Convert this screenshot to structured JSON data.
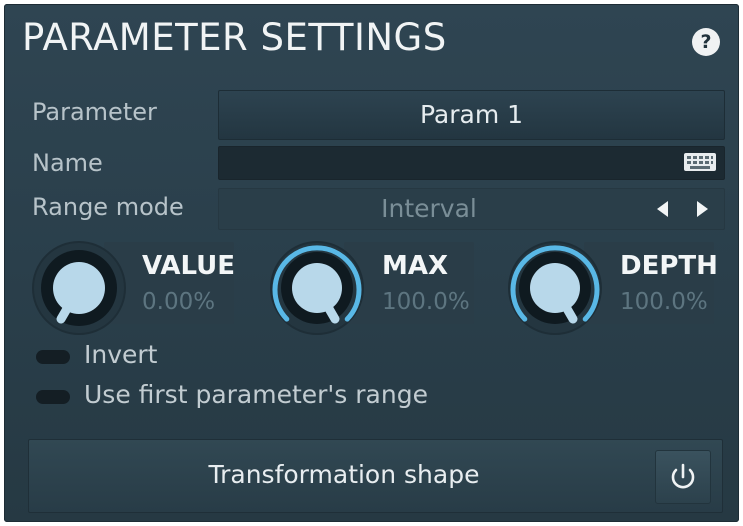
{
  "title": "PARAMETER SETTINGS",
  "help_label": "?",
  "parameter": {
    "label": "Parameter",
    "value": "Param 1"
  },
  "name": {
    "label": "Name",
    "value": "",
    "keyboard_icon": "keyboard-icon"
  },
  "range_mode": {
    "label": "Range mode",
    "value": "Interval",
    "prev_icon": "arrow-left-icon",
    "next_icon": "arrow-right-icon"
  },
  "knobs": [
    {
      "name": "VALUE",
      "value": "0.00%",
      "level": 0.0
    },
    {
      "name": "MAX",
      "value": "100.0%",
      "level": 1.0
    },
    {
      "name": "DEPTH",
      "value": "100.0%",
      "level": 1.0
    }
  ],
  "toggles": [
    {
      "label": "Invert",
      "on": false
    },
    {
      "label": "Use first parameter's range",
      "on": false
    }
  ],
  "shape_button": {
    "label": "Transformation shape",
    "power_icon": "power-icon"
  },
  "colors": {
    "accent": "#59b8e6",
    "panel": "#2b4049",
    "text": "#f1f4f5",
    "dim_value": "#5d7580"
  }
}
